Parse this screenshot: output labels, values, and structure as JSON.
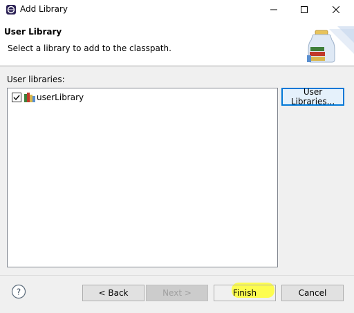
{
  "window": {
    "title": "Add Library",
    "icons": {
      "app": "eclipse-icon",
      "minimize": "minimize-icon",
      "maximize": "maximize-icon",
      "close": "close-icon"
    }
  },
  "header": {
    "title": "User Library",
    "description": "Select a library to add to the classpath.",
    "art": "library-jar-books-icon"
  },
  "list": {
    "label": "User libraries:",
    "items": [
      {
        "label": "userLibrary",
        "checked": true,
        "icon": "library-icon"
      }
    ]
  },
  "buttons": {
    "user_libraries": "User Libraries...",
    "back": "< Back",
    "next": "Next >",
    "finish": "Finish",
    "cancel": "Cancel"
  },
  "help": {
    "icon": "help-icon"
  },
  "colors": {
    "highlight": "#ffff33",
    "focus_border": "#0078d7"
  }
}
